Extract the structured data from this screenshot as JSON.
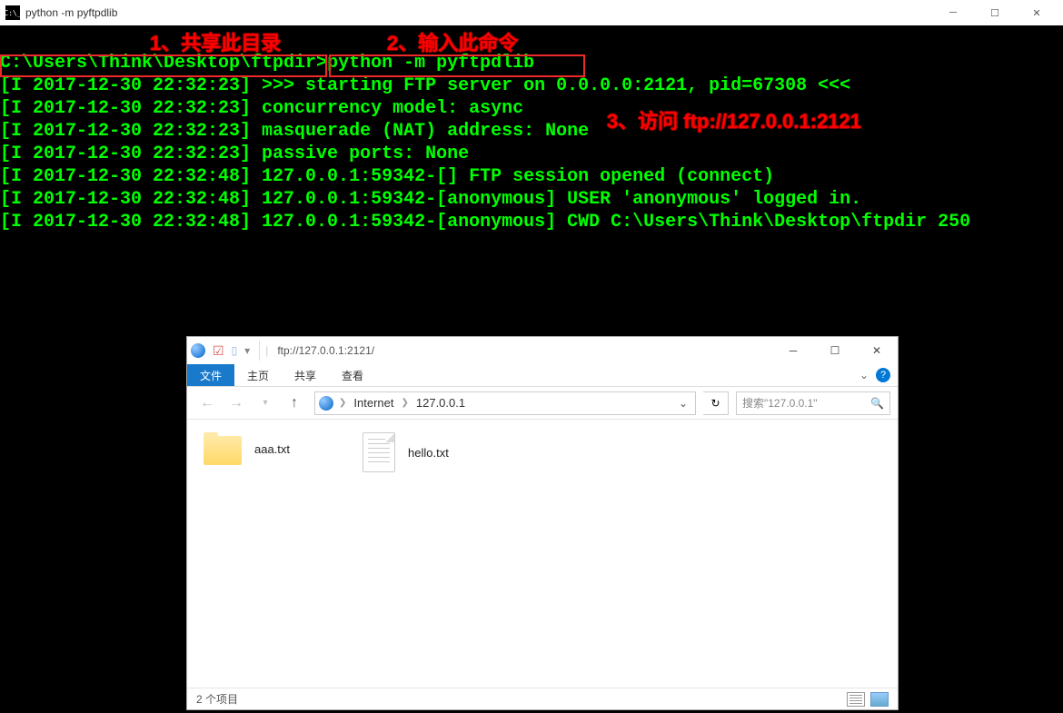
{
  "cmd_window": {
    "title": "python  -m pyftpdlib",
    "icon_text": "C:\\_"
  },
  "annotations": {
    "a1": "1、共享此目录",
    "a2": "2、输入此命令",
    "a3": "3、访问 ftp://127.0.0.1:2121"
  },
  "prompt": {
    "path": "C:\\Users\\Think\\Desktop\\ftpdir>",
    "command": "python -m pyftpdlib"
  },
  "log_lines": [
    "[I 2017-12-30 22:32:23] >>> starting FTP server on 0.0.0.0:2121, pid=67308 <<<",
    "[I 2017-12-30 22:32:23] concurrency model: async",
    "[I 2017-12-30 22:32:23] masquerade (NAT) address: None",
    "[I 2017-12-30 22:32:23] passive ports: None",
    "[I 2017-12-30 22:32:48] 127.0.0.1:59342-[] FTP session opened (connect)",
    "[I 2017-12-30 22:32:48] 127.0.0.1:59342-[anonymous] USER 'anonymous' logged in.",
    "[I 2017-12-30 22:32:48] 127.0.0.1:59342-[anonymous] CWD C:\\Users\\Think\\Desktop\\ftpdir 250"
  ],
  "explorer": {
    "title_path": "ftp://127.0.0.1:2121/",
    "tabs": {
      "file": "文件",
      "home": "主页",
      "share": "共享",
      "view": "查看"
    },
    "breadcrumb": {
      "root": "Internet",
      "host": "127.0.0.1"
    },
    "search_placeholder": "搜索\"127.0.0.1\"",
    "files": [
      {
        "name": "aaa.txt",
        "kind": "folder"
      },
      {
        "name": "hello.txt",
        "kind": "txt"
      }
    ],
    "status": "2 个项目"
  }
}
